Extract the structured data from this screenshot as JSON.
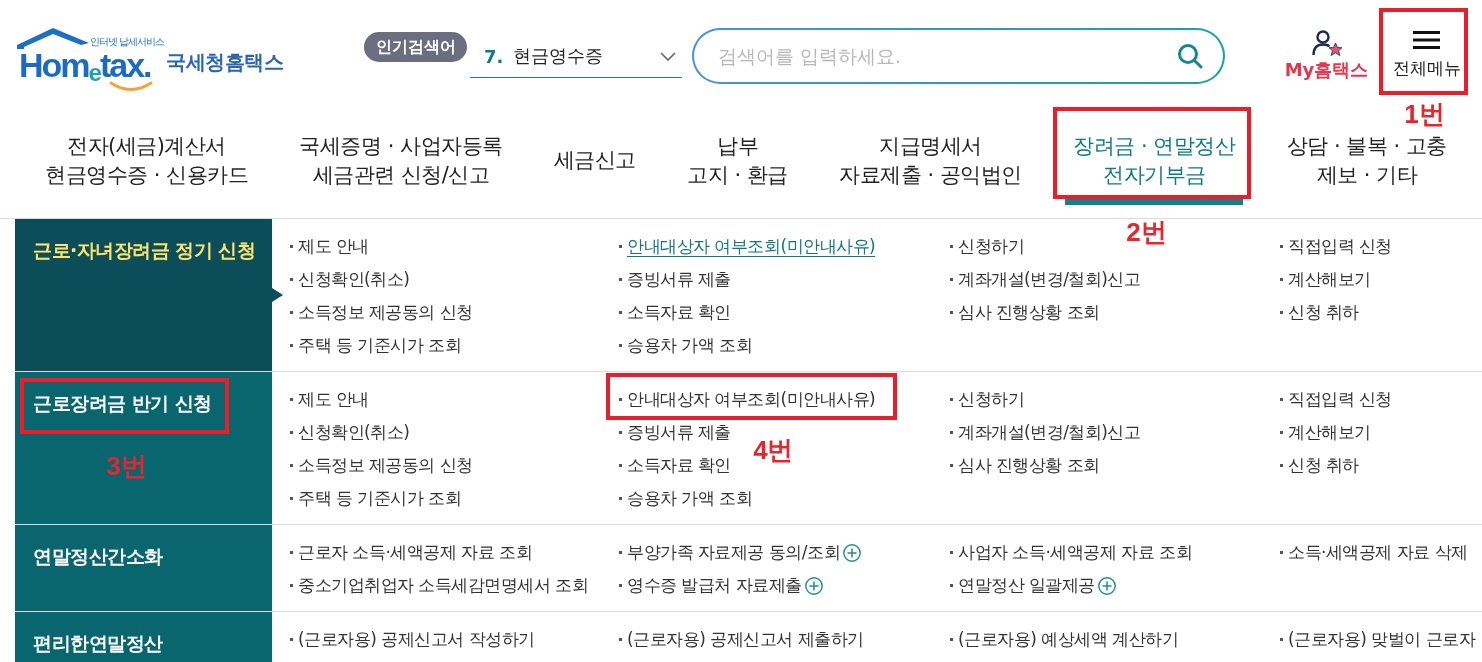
{
  "header": {
    "logo": {
      "tagline": "인터넷 납세서비스",
      "wordmark": "Hom$_{e}$tax.",
      "title": "국세청홈택스"
    },
    "popular_search": {
      "badge": "인기검색어",
      "rank": "7.",
      "keyword": "현금영수증"
    },
    "search": {
      "placeholder": "검색어를 입력하세요."
    },
    "my_hometax": {
      "label": "My홈택스"
    },
    "full_menu": {
      "label": "전체메뉴",
      "annotation": "1번"
    }
  },
  "nav": [
    {
      "label": "전자(세금)계산서\n현금영수증 · 신용카드",
      "selected": false
    },
    {
      "label": "국세증명 · 사업자등록\n세금관련 신청/신고",
      "selected": false
    },
    {
      "label": "세금신고",
      "selected": false
    },
    {
      "label": "납부\n고지 · 환급",
      "selected": false
    },
    {
      "label": "지급명세서\n자료제출 · 공익법인",
      "selected": false
    },
    {
      "label": "장려금 · 연말정산\n전자기부금",
      "selected": true,
      "annotation": "2번"
    },
    {
      "label": "상담 · 불복 · 고충\n제보 · 기타",
      "selected": false
    }
  ],
  "menu": [
    {
      "title": "근로·자녀장려금 정기 신청",
      "selected": true,
      "columns": [
        [
          {
            "label": "제도 안내",
            "selected": false,
            "expandable": false
          },
          {
            "label": "신청확인(취소)",
            "selected": false,
            "expandable": false
          },
          {
            "label": "소득정보 제공동의 신청",
            "selected": false,
            "expandable": false
          },
          {
            "label": "주택 등 기준시가 조회",
            "selected": false,
            "expandable": false
          }
        ],
        [
          {
            "label": "안내대상자 여부조회(미안내사유)",
            "selected": true,
            "expandable": false
          },
          {
            "label": "증빙서류 제출",
            "selected": false,
            "expandable": false
          },
          {
            "label": "소득자료 확인",
            "selected": false,
            "expandable": false
          },
          {
            "label": "승용차 가액 조회",
            "selected": false,
            "expandable": false
          }
        ],
        [
          {
            "label": "신청하기",
            "selected": false,
            "expandable": false
          },
          {
            "label": "계좌개설(변경/철회)신고",
            "selected": false,
            "expandable": false
          },
          {
            "label": "심사 진행상황 조회",
            "selected": false,
            "expandable": false
          }
        ],
        [
          {
            "label": "직접입력 신청",
            "selected": false,
            "expandable": false
          },
          {
            "label": "계산해보기",
            "selected": false,
            "expandable": false
          },
          {
            "label": "신청 취하",
            "selected": false,
            "expandable": false
          }
        ]
      ]
    },
    {
      "title": "근로장려금 반기 신청",
      "selected": false,
      "annotation": "3번",
      "columns": [
        [
          {
            "label": "제도 안내",
            "selected": false,
            "expandable": false
          },
          {
            "label": "신청확인(취소)",
            "selected": false,
            "expandable": false
          },
          {
            "label": "소득정보 제공동의 신청",
            "selected": false,
            "expandable": false
          },
          {
            "label": "주택 등 기준시가 조회",
            "selected": false,
            "expandable": false
          }
        ],
        [
          {
            "label": "안내대상자 여부조회(미안내사유)",
            "selected": false,
            "expandable": false,
            "annotation": "4번"
          },
          {
            "label": "증빙서류 제출",
            "selected": false,
            "expandable": false
          },
          {
            "label": "소득자료 확인",
            "selected": false,
            "expandable": false
          },
          {
            "label": "승용차 가액 조회",
            "selected": false,
            "expandable": false
          }
        ],
        [
          {
            "label": "신청하기",
            "selected": false,
            "expandable": false
          },
          {
            "label": "계좌개설(변경/철회)신고",
            "selected": false,
            "expandable": false
          },
          {
            "label": "심사 진행상황 조회",
            "selected": false,
            "expandable": false
          }
        ],
        [
          {
            "label": "직접입력 신청",
            "selected": false,
            "expandable": false
          },
          {
            "label": "계산해보기",
            "selected": false,
            "expandable": false
          },
          {
            "label": "신청 취하",
            "selected": false,
            "expandable": false
          }
        ]
      ]
    },
    {
      "title": "연말정산간소화",
      "selected": false,
      "columns": [
        [
          {
            "label": "근로자 소득·세액공제 자료 조회",
            "selected": false,
            "expandable": false
          },
          {
            "label": "중소기업취업자 소득세감면명세서 조회",
            "selected": false,
            "expandable": false
          }
        ],
        [
          {
            "label": "부양가족 자료제공 동의/조회",
            "selected": false,
            "expandable": true
          },
          {
            "label": "영수증 발급처 자료제출",
            "selected": false,
            "expandable": true
          }
        ],
        [
          {
            "label": "사업자 소득·세액공제 자료 조회",
            "selected": false,
            "expandable": false
          },
          {
            "label": "연말정산 일괄제공",
            "selected": false,
            "expandable": true
          }
        ],
        [
          {
            "label": "소득·세액공제 자료 삭제",
            "selected": false,
            "expandable": false
          }
        ]
      ]
    },
    {
      "title": "편리한연말정산",
      "selected": false,
      "columns": [
        [
          {
            "label": "(근로자용) 공제신고서 작성하기",
            "selected": false,
            "expandable": false
          }
        ],
        [
          {
            "label": "(근로자용) 공제신고서 제출하기",
            "selected": false,
            "expandable": false
          }
        ],
        [
          {
            "label": "(근로자용) 예상세액 계산하기",
            "selected": false,
            "expandable": false
          }
        ],
        [
          {
            "label": "(근로자용) 맞벌이 근로자",
            "selected": false,
            "expandable": false
          }
        ]
      ]
    }
  ]
}
